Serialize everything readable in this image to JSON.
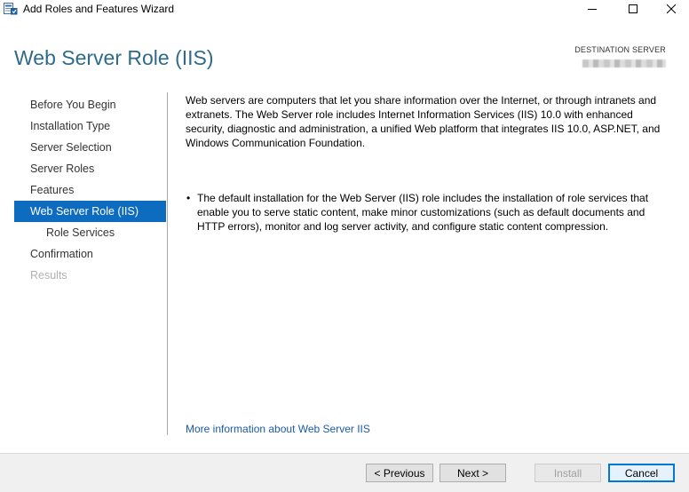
{
  "window": {
    "title": "Add Roles and Features Wizard",
    "icon": "server-manager-wizard-icon",
    "controls": [
      "minimize-icon",
      "maximize-icon",
      "close-icon"
    ]
  },
  "header": {
    "page_title": "Web Server Role (IIS)",
    "destination_label": "DESTINATION SERVER"
  },
  "nav": {
    "items": [
      {
        "label": "Before You Begin",
        "state": "normal"
      },
      {
        "label": "Installation Type",
        "state": "normal"
      },
      {
        "label": "Server Selection",
        "state": "normal"
      },
      {
        "label": "Server Roles",
        "state": "normal"
      },
      {
        "label": "Features",
        "state": "normal"
      },
      {
        "label": "Web Server Role (IIS)",
        "state": "active"
      },
      {
        "label": "Role Services",
        "state": "sub"
      },
      {
        "label": "Confirmation",
        "state": "normal"
      },
      {
        "label": "Results",
        "state": "disabled"
      }
    ]
  },
  "content": {
    "intro": "Web servers are computers that let you share information over the Internet, or through intranets and extranets. The Web Server role includes Internet Information Services (IIS) 10.0 with enhanced security, diagnostic and administration, a unified Web platform that integrates IIS 10.0, ASP.NET, and Windows Communication Foundation.",
    "bullet_symbol": "•",
    "bullets": [
      "The default installation for the Web Server (IIS) role includes the installation of role services that enable you to serve static content, make minor customizations (such as default documents and HTTP errors), monitor and log server activity, and configure static content compression."
    ],
    "more_link": "More information about Web Server IIS"
  },
  "footer": {
    "previous_label": "< Previous",
    "next_label": "Next >",
    "install_label": "Install",
    "cancel_label": "Cancel"
  },
  "colors": {
    "title_blue": "#2e6b8a",
    "active_nav_bg": "#0e6cc0",
    "link_blue": "#1a5aa8",
    "footer_bg": "#f0f0f0"
  }
}
